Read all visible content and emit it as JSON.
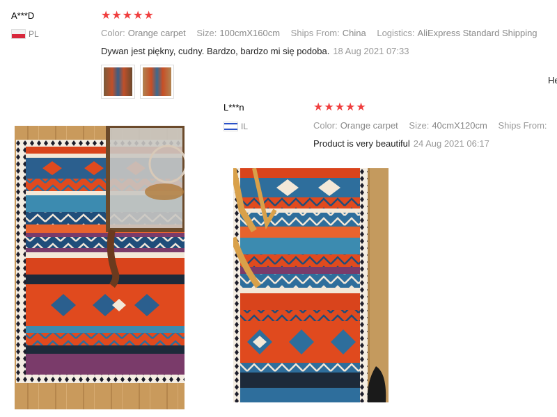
{
  "reviews": [
    {
      "name": "A***D",
      "country": "PL",
      "stars": "★★★★★",
      "rating": 5,
      "attrs": [
        {
          "label": "Color:",
          "value": "Orange carpet"
        },
        {
          "label": "Size:",
          "value": "100cmX160cm"
        },
        {
          "label": "Ships From:",
          "value": "China"
        },
        {
          "label": "Logistics:",
          "value": "AliExpress Standard Shipping"
        }
      ],
      "text": "Dywan jest piękny, cudny. Bardzo, bardzo mi się podoba.",
      "date": "18 Aug 2021 07:33"
    },
    {
      "name": "L***n",
      "country": "IL",
      "stars": "★★★★★",
      "rating": 5,
      "attrs": [
        {
          "label": "Color:",
          "value": "Orange carpet"
        },
        {
          "label": "Size:",
          "value": "40cmX120cm"
        },
        {
          "label": "Ships From:",
          "value": ""
        }
      ],
      "text": "Product is very beautiful",
      "date": "24 Aug 2021 06:17"
    }
  ],
  "edge_text": "He",
  "colors": {
    "star": "#f03e3e",
    "rug_orange": "#e0461d",
    "rug_blue": "#2e6e9c",
    "floor": "#c49a5e"
  }
}
